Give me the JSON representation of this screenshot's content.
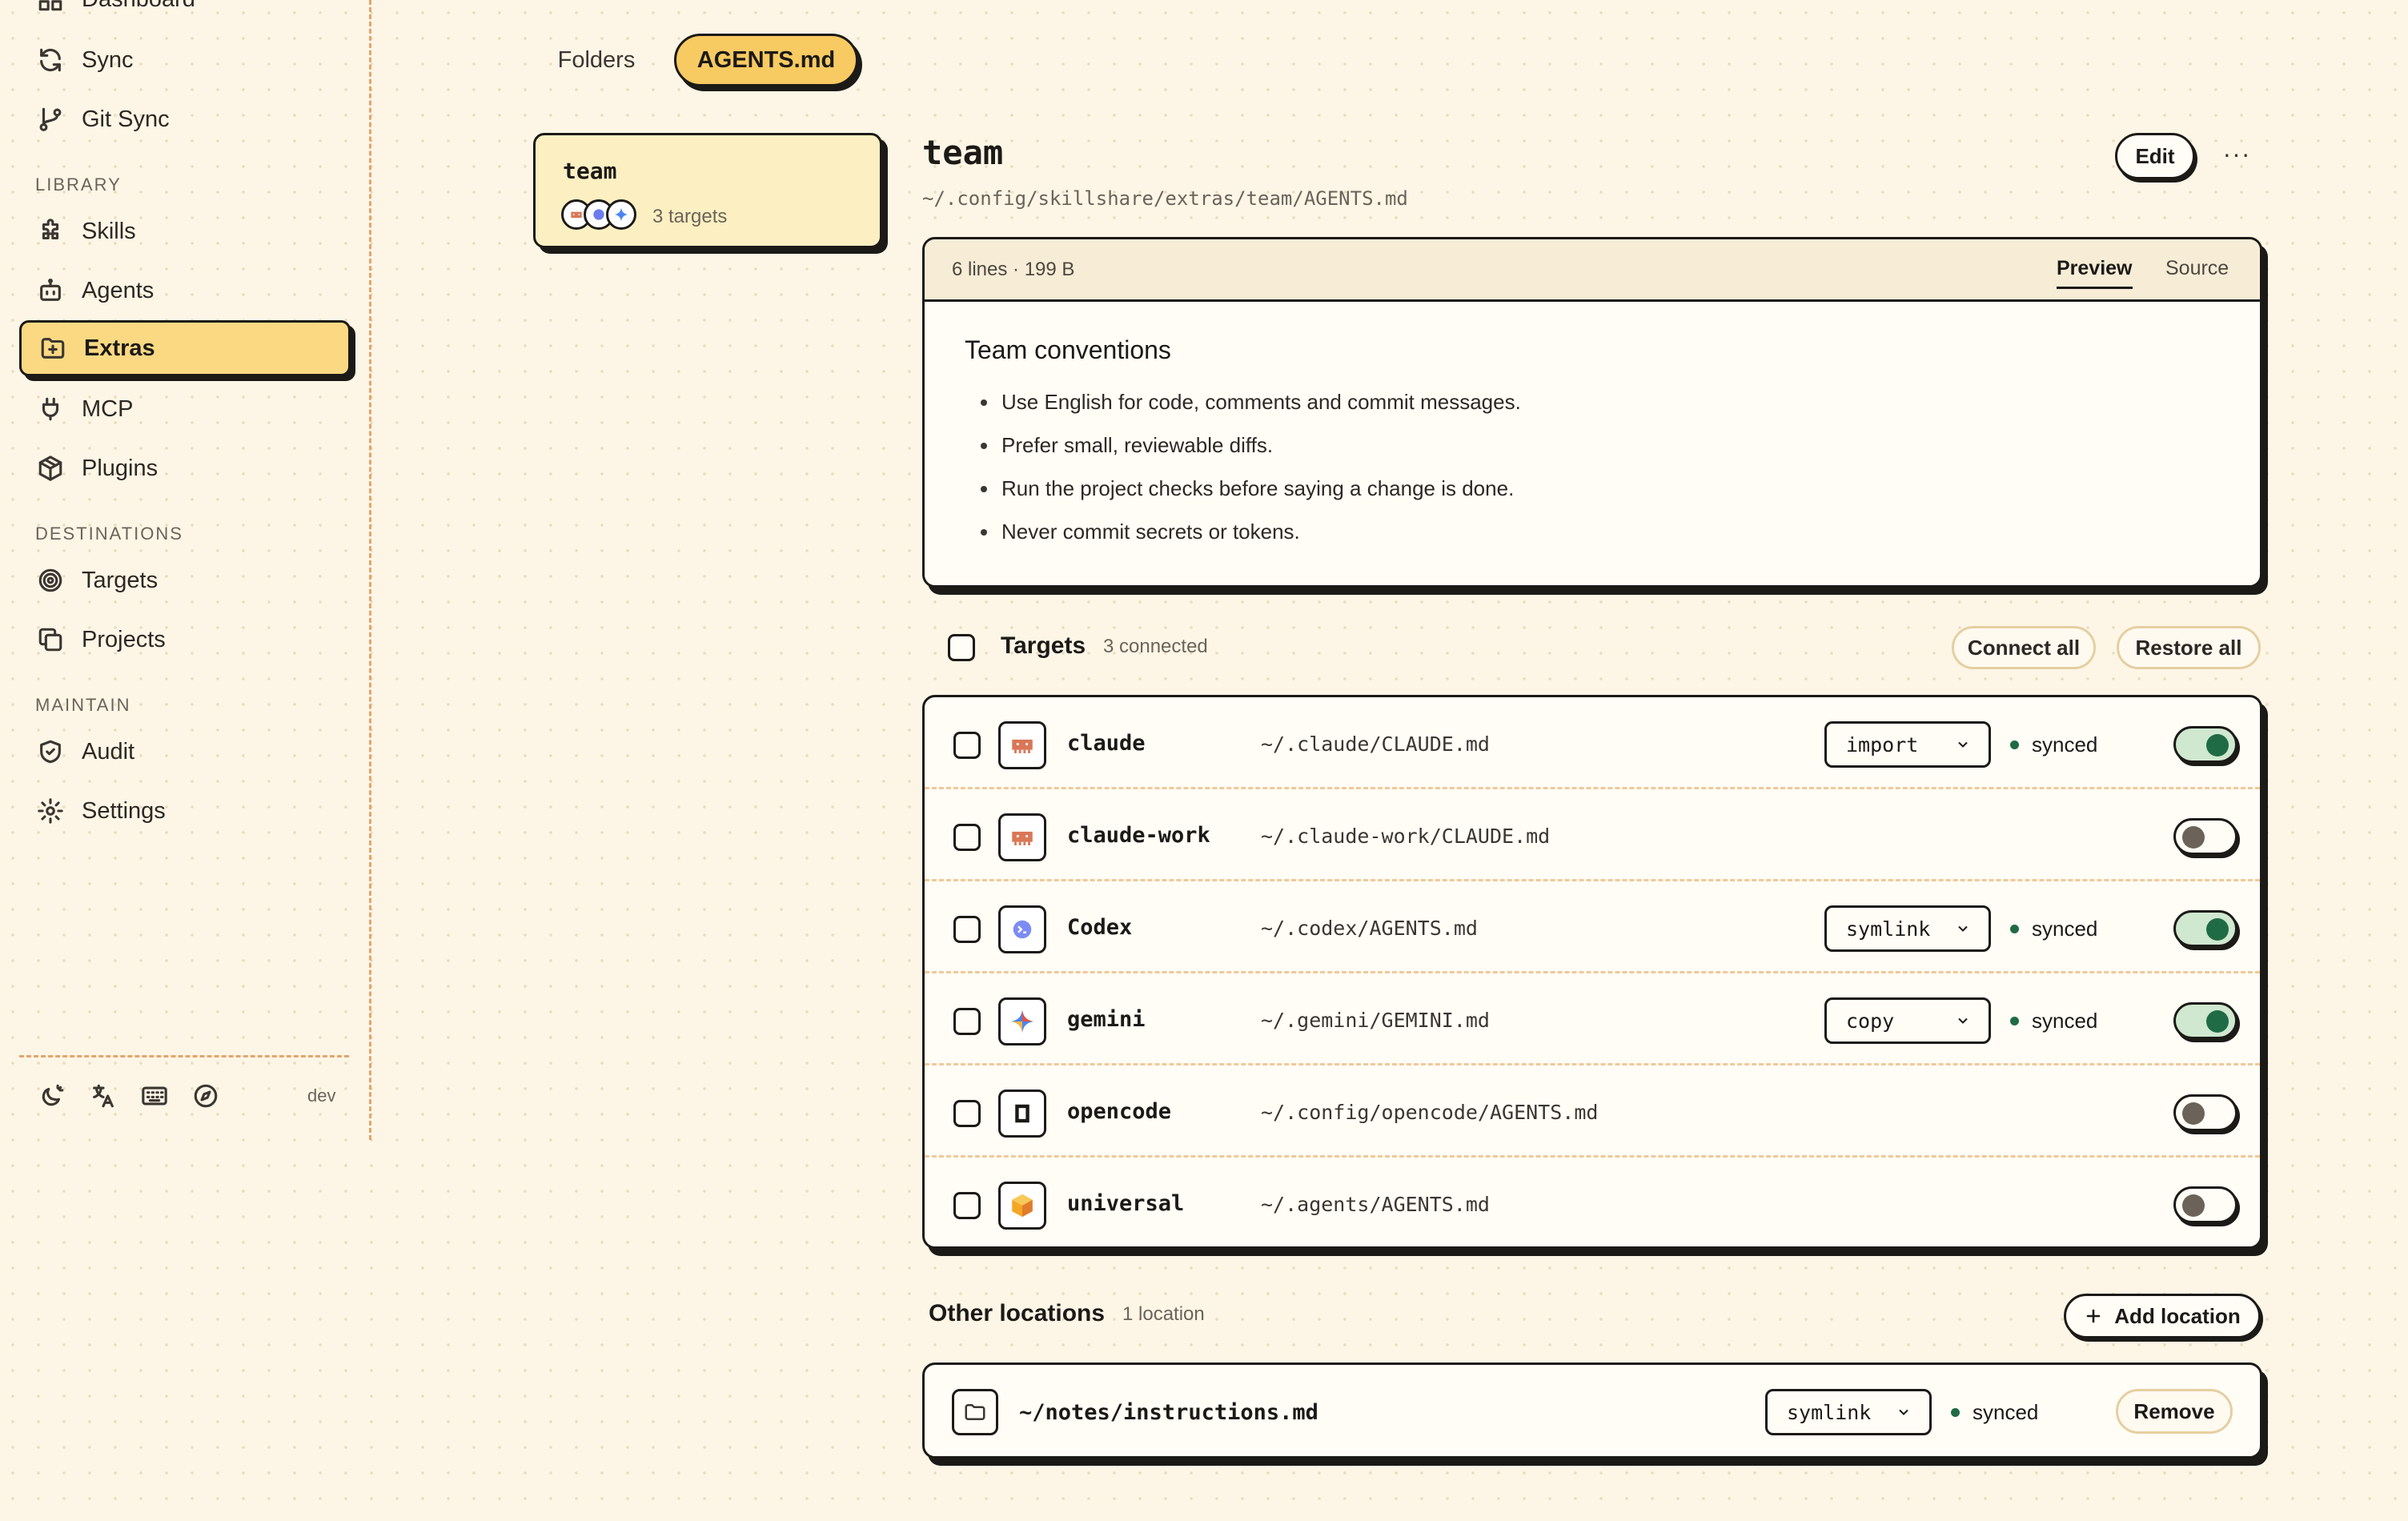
{
  "sidebar": {
    "nav_top": [
      {
        "label": "Dashboard",
        "icon": "dashboard-icon"
      },
      {
        "label": "Sync",
        "icon": "sync-icon"
      },
      {
        "label": "Git Sync",
        "icon": "git-branch-icon"
      }
    ],
    "sections": [
      {
        "title": "LIBRARY",
        "items": [
          {
            "label": "Skills",
            "icon": "puzzle-icon"
          },
          {
            "label": "Agents",
            "icon": "bot-icon"
          },
          {
            "label": "Extras",
            "icon": "folder-plus-icon",
            "active": true
          },
          {
            "label": "MCP",
            "icon": "plug-icon"
          },
          {
            "label": "Plugins",
            "icon": "package-icon"
          }
        ]
      },
      {
        "title": "DESTINATIONS",
        "items": [
          {
            "label": "Targets",
            "icon": "target-icon"
          },
          {
            "label": "Projects",
            "icon": "copy-icon"
          }
        ]
      },
      {
        "title": "MAINTAIN",
        "items": [
          {
            "label": "Audit",
            "icon": "shield-icon"
          },
          {
            "label": "Settings",
            "icon": "gear-icon"
          }
        ]
      }
    ],
    "footer": {
      "icons": [
        "theme-icon",
        "translate-icon",
        "keyboard-icon",
        "compass-icon"
      ],
      "env": "dev"
    }
  },
  "tabs": {
    "folders": "Folders",
    "agents_md": "AGENTS.md"
  },
  "file_list": [
    {
      "name": "team",
      "targets_label": "3 targets"
    }
  ],
  "file": {
    "title": "team",
    "path": "~/.config/skillshare/extras/team/AGENTS.md",
    "edit_label": "Edit",
    "more_label": "···"
  },
  "preview": {
    "meta": "6 lines · 199 B",
    "tab_preview": "Preview",
    "tab_source": "Source",
    "heading": "Team conventions",
    "bullets": [
      "Use English for code, comments and commit messages.",
      "Prefer small, reviewable diffs.",
      "Run the project checks before saying a change is done.",
      "Never commit secrets or tokens."
    ]
  },
  "targets": {
    "title": "Targets",
    "count": "3 connected",
    "connect_all": "Connect all",
    "restore_all": "Restore all",
    "rows": [
      {
        "name": "claude",
        "path": "~/.claude/CLAUDE.md",
        "mode": "import",
        "status": "synced",
        "enabled": true
      },
      {
        "name": "claude-work",
        "path": "~/.claude-work/CLAUDE.md",
        "mode": "",
        "status": "",
        "enabled": false
      },
      {
        "name": "Codex",
        "path": "~/.codex/AGENTS.md",
        "mode": "symlink",
        "status": "synced",
        "enabled": true
      },
      {
        "name": "gemini",
        "path": "~/.gemini/GEMINI.md",
        "mode": "copy",
        "status": "synced",
        "enabled": true
      },
      {
        "name": "opencode",
        "path": "~/.config/opencode/AGENTS.md",
        "mode": "",
        "status": "",
        "enabled": false
      },
      {
        "name": "universal",
        "path": "~/.agents/AGENTS.md",
        "mode": "",
        "status": "",
        "enabled": false
      }
    ]
  },
  "other_locations": {
    "title": "Other locations",
    "count": "1 location",
    "add_label": "Add location",
    "items": [
      {
        "path": "~/notes/instructions.md",
        "mode": "symlink",
        "status": "synced",
        "remove_label": "Remove"
      }
    ]
  },
  "colors": {
    "accent": "#f8ca62",
    "active_nav": "#fbd983",
    "synced": "#1f6b45",
    "claude": "#d97757"
  }
}
